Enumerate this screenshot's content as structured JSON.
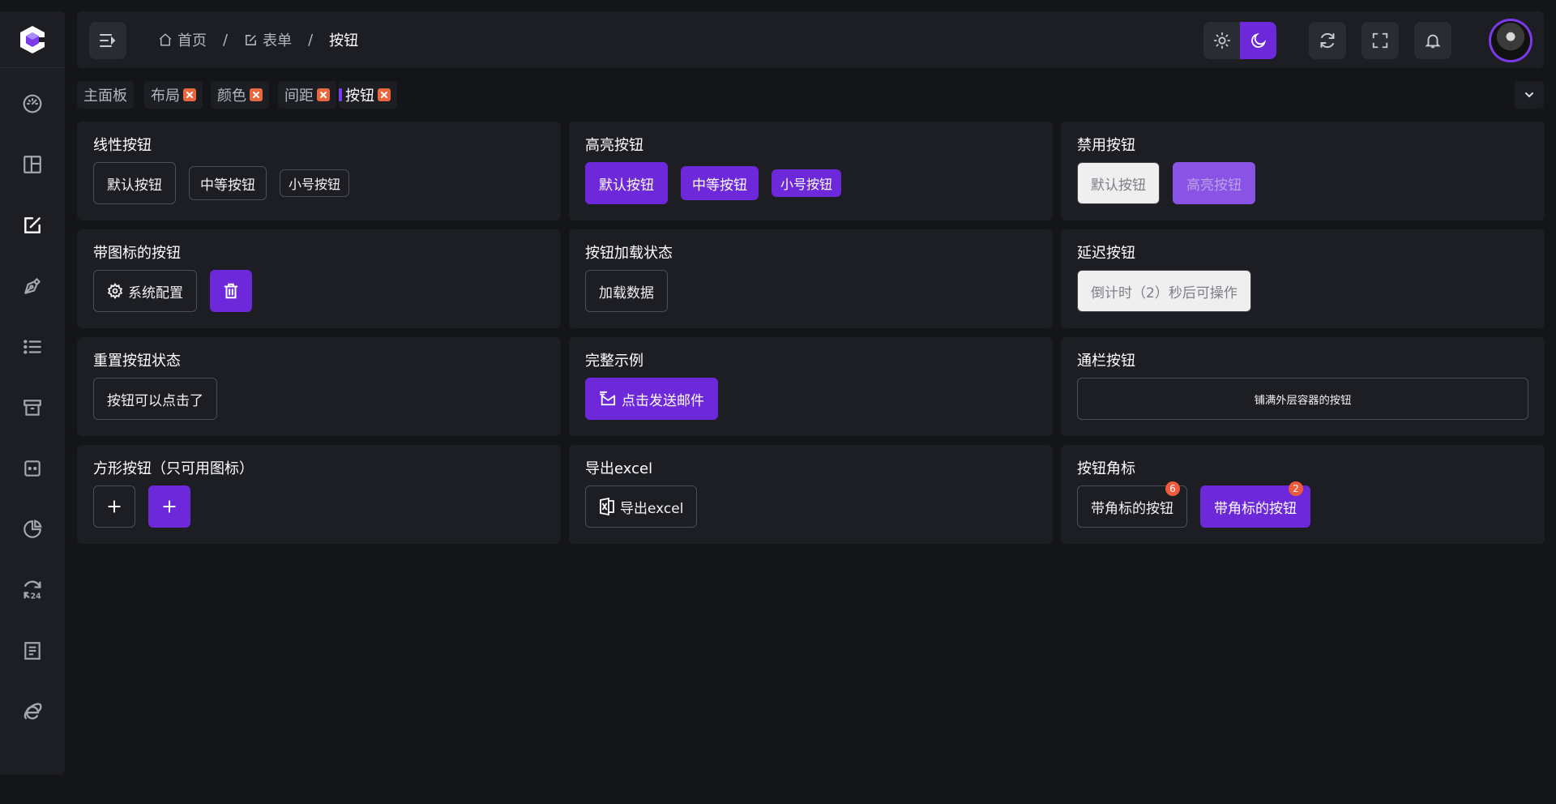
{
  "colors": {
    "accent": "#6d28d9",
    "badge": "#ef5a3c",
    "tab_close": "#e8673c",
    "panel": "#1d1e24",
    "background": "#141519"
  },
  "sidebar": {
    "logo_icon": "cube-logo-icon",
    "items": [
      {
        "icon": "dashboard-gauge-icon",
        "active": false
      },
      {
        "icon": "layout-icon",
        "active": false
      },
      {
        "icon": "form-edit-icon",
        "active": true
      },
      {
        "icon": "pen-nib-icon",
        "active": false
      },
      {
        "icon": "list-icon",
        "active": false
      },
      {
        "icon": "archive-box-icon",
        "active": false
      },
      {
        "icon": "chat-bubble-icon",
        "active": false
      },
      {
        "icon": "pie-chart-icon",
        "active": false
      },
      {
        "icon": "24h-refresh-icon",
        "active": false
      },
      {
        "icon": "document-icon",
        "active": false
      },
      {
        "icon": "ie-browser-icon",
        "active": false
      }
    ]
  },
  "header": {
    "breadcrumb": [
      {
        "label": "首页",
        "icon": "home-icon"
      },
      {
        "label": "表单",
        "icon": "edit-icon"
      },
      {
        "label": "按钮"
      }
    ],
    "separator": "/",
    "theme": {
      "active": "dark"
    }
  },
  "tabs": [
    {
      "label": "主面板",
      "closable": false,
      "active": false
    },
    {
      "label": "布局",
      "closable": true,
      "active": false
    },
    {
      "label": "颜色",
      "closable": true,
      "active": false
    },
    {
      "label": "间距",
      "closable": true,
      "active": false
    },
    {
      "label": "按钮",
      "closable": true,
      "active": true
    }
  ],
  "cards": {
    "outline": {
      "title": "线性按钮",
      "buttons": [
        "默认按钮",
        "中等按钮",
        "小号按钮"
      ]
    },
    "highlight": {
      "title": "高亮按钮",
      "buttons": [
        "默认按钮",
        "中等按钮",
        "小号按钮"
      ]
    },
    "disabled": {
      "title": "禁用按钮",
      "buttons": [
        "默认按钮",
        "高亮按钮"
      ]
    },
    "with_icon": {
      "title": "带图标的按钮",
      "config_label": "系统配置"
    },
    "loading": {
      "title": "按钮加载状态",
      "button": "加载数据"
    },
    "delay": {
      "title": "延迟按钮",
      "button": "倒计时（2）秒后可操作"
    },
    "reset": {
      "title": "重置按钮状态",
      "button": "按钮可以点击了"
    },
    "full": {
      "title": "完整示例",
      "button": "点击发送邮件"
    },
    "block": {
      "title": "通栏按钮",
      "button": "铺满外层容器的按钮"
    },
    "square": {
      "title": "方形按钮（只可用图标）"
    },
    "export": {
      "title": "导出excel",
      "button": "导出excel"
    },
    "badge": {
      "title": "按钮角标",
      "buttons": [
        {
          "label": "带角标的按钮",
          "badge": "6"
        },
        {
          "label": "带角标的按钮",
          "badge": "2"
        }
      ]
    }
  }
}
